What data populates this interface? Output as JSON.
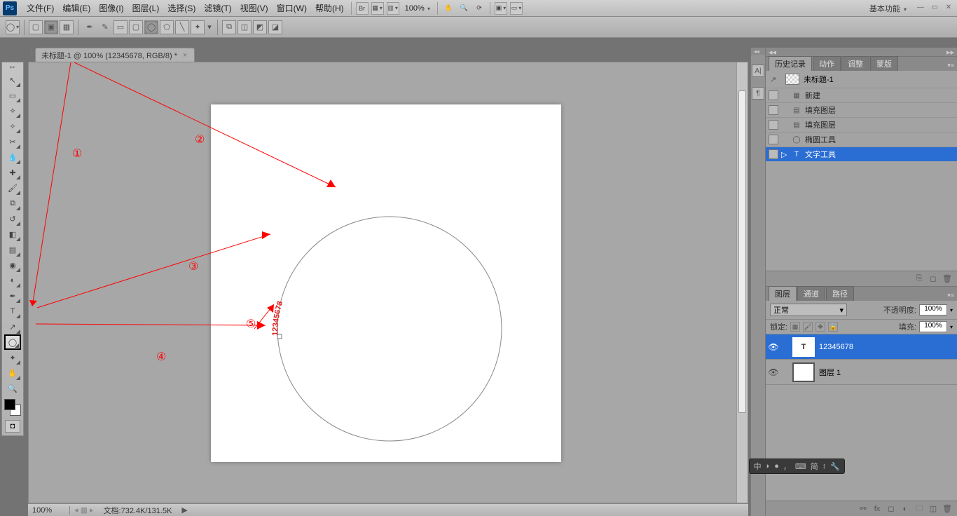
{
  "menubar": {
    "items": [
      "文件(F)",
      "编辑(E)",
      "图像(I)",
      "图层(L)",
      "选择(S)",
      "滤镜(T)",
      "视图(V)",
      "窗口(W)",
      "帮助(H)"
    ],
    "zoom": "100%",
    "workspace": "基本功能"
  },
  "docTab": {
    "label": "未标题-1 @ 100% (12345678, RGB/8) *"
  },
  "canvas": {
    "pathText": "12345678"
  },
  "annotations": {
    "labels": [
      "①",
      "②",
      "③",
      "④",
      "⑤"
    ]
  },
  "history": {
    "tabs": [
      "历史记录",
      "动作",
      "调整",
      "蒙版"
    ],
    "docName": "未标题-1",
    "items": [
      {
        "icon": "new",
        "label": "新建"
      },
      {
        "icon": "fill",
        "label": "填充图层"
      },
      {
        "icon": "fill",
        "label": "填充图层"
      },
      {
        "icon": "ellipse",
        "label": "椭圆工具"
      },
      {
        "icon": "type",
        "label": "文字工具"
      }
    ],
    "selectedIndex": 4
  },
  "layers": {
    "tabs": [
      "图层",
      "通道",
      "路径"
    ],
    "blendMode": "正常",
    "opacityLabel": "不透明度:",
    "opacityVal": "100%",
    "lockLabel": "锁定:",
    "fillLabel": "填充:",
    "fillVal": "100%",
    "items": [
      {
        "name": "12345678",
        "thumb": "T",
        "selected": true
      },
      {
        "name": "图层 1",
        "thumb": "",
        "selected": false
      }
    ]
  },
  "status": {
    "zoom": "100%",
    "doc": "文档:732.4K/131.5K"
  },
  "ime": {
    "parts": [
      "中",
      "",
      "",
      "，",
      "简",
      ""
    ]
  },
  "collapse": {
    "icons": [
      "A|",
      "¶"
    ]
  }
}
